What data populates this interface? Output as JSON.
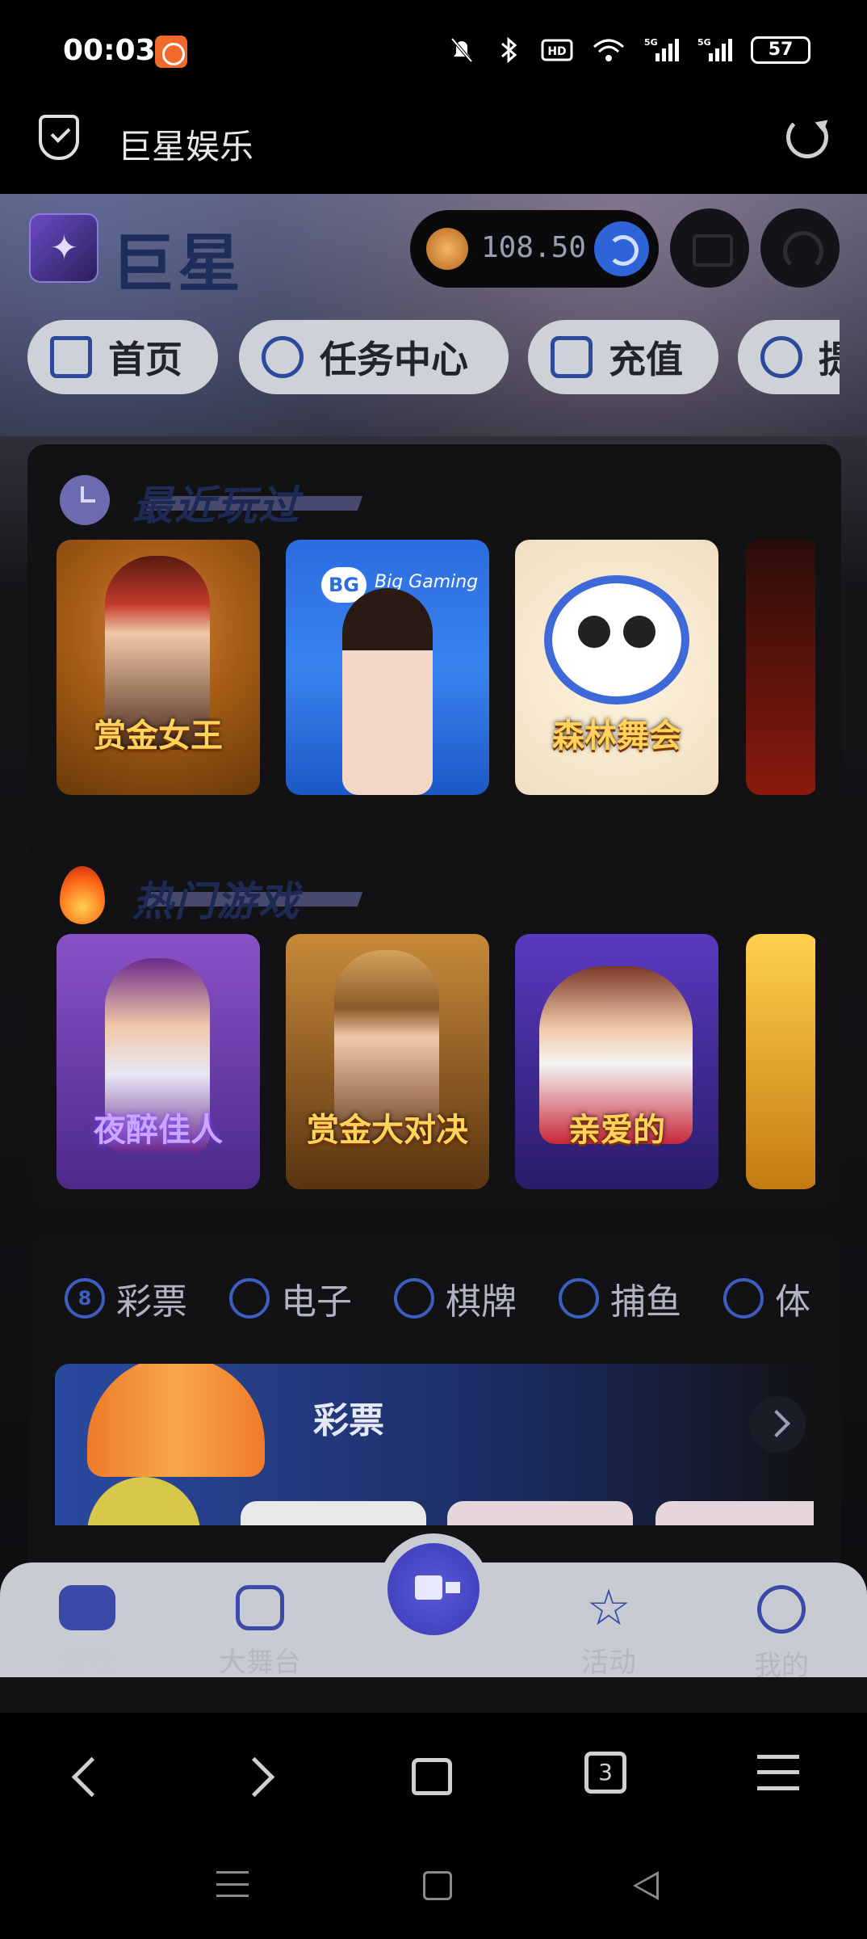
{
  "status_bar": {
    "time": "00:03",
    "battery": "57",
    "network": "5G"
  },
  "browser": {
    "title": "巨星娱乐",
    "tab_count": "3"
  },
  "header": {
    "brand": "巨星",
    "balance": "108.50"
  },
  "nav": {
    "items": [
      {
        "label": "首页",
        "icon": "home-icon"
      },
      {
        "label": "任务中心",
        "icon": "target-icon"
      },
      {
        "label": "充值",
        "icon": "wallet-icon"
      },
      {
        "label": "提",
        "icon": "money-icon"
      }
    ]
  },
  "recent": {
    "title": "最近玩过",
    "games": [
      {
        "label": "赏金女王"
      },
      {
        "label": "Big Gaming"
      },
      {
        "label": "森林舞会"
      },
      {
        "label": ""
      }
    ]
  },
  "hot": {
    "title": "热门游戏",
    "games": [
      {
        "label": "夜醉佳人"
      },
      {
        "label": "赏金大对决"
      },
      {
        "label": "亲爱的"
      },
      {
        "label": ""
      }
    ]
  },
  "categories": {
    "items": [
      {
        "label": "彩票",
        "icon": "8"
      },
      {
        "label": "电子"
      },
      {
        "label": "棋牌"
      },
      {
        "label": "捕鱼"
      },
      {
        "label": "体"
      }
    ],
    "banner_title": "彩票"
  },
  "tabbar": {
    "items": [
      {
        "label": "游戏"
      },
      {
        "label": "大舞台"
      },
      {
        "label": "活动"
      },
      {
        "label": "我的"
      }
    ]
  },
  "colors": {
    "accent": "#3b49a8",
    "pill_bg": "#cfd1d8",
    "card_bg": "#121215"
  }
}
